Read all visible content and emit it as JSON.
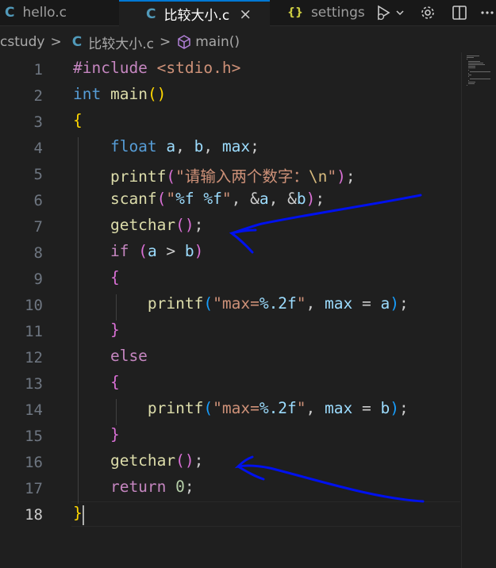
{
  "tabs": [
    {
      "icon": "C",
      "label": "hello.c"
    },
    {
      "icon": "C",
      "label": "比较大小.c",
      "close": "×"
    },
    {
      "icon": "{}",
      "label": "settings"
    }
  ],
  "breadcrumb": {
    "folder": "cstudy",
    "sep": ">",
    "file_icon": "C",
    "file": "比较大小.c",
    "symbol": "main()"
  },
  "code": {
    "line_numbers": [
      "1",
      "2",
      "3",
      "4",
      "5",
      "6",
      "7",
      "8",
      "9",
      "10",
      "11",
      "12",
      "13",
      "14",
      "15",
      "16",
      "17",
      "18"
    ],
    "active_line": "18",
    "lines": [
      [
        {
          "t": "#include ",
          "c": "ctrl"
        },
        {
          "t": "<stdio.h>",
          "c": "str"
        }
      ],
      [
        {
          "t": "int ",
          "c": "kw"
        },
        {
          "t": "main",
          "c": "fn"
        },
        {
          "t": "()",
          "c": "b1"
        }
      ],
      [
        {
          "t": "{",
          "c": "b1"
        }
      ],
      [
        {
          "t": "    float ",
          "c": "kw"
        },
        {
          "t": "a",
          "c": "var"
        },
        {
          "t": ", ",
          "c": "pun"
        },
        {
          "t": "b",
          "c": "var"
        },
        {
          "t": ", ",
          "c": "pun"
        },
        {
          "t": "max",
          "c": "var"
        },
        {
          "t": ";",
          "c": "pun"
        }
      ],
      [
        {
          "t": "    printf",
          "c": "fn"
        },
        {
          "t": "(",
          "c": "b2"
        },
        {
          "t": "\"请输入两个数字：",
          "c": "str"
        },
        {
          "t": "\\n",
          "c": "esc"
        },
        {
          "t": "\"",
          "c": "str"
        },
        {
          "t": ")",
          "c": "b2"
        },
        {
          "t": ";",
          "c": "pun"
        }
      ],
      [
        {
          "t": "    scanf",
          "c": "fn"
        },
        {
          "t": "(",
          "c": "b2"
        },
        {
          "t": "\"",
          "c": "str"
        },
        {
          "t": "%f",
          "c": "var"
        },
        {
          "t": " ",
          "c": "str"
        },
        {
          "t": "%f",
          "c": "var"
        },
        {
          "t": "\"",
          "c": "str"
        },
        {
          "t": ", &",
          "c": "pun"
        },
        {
          "t": "a",
          "c": "var"
        },
        {
          "t": ", &",
          "c": "pun"
        },
        {
          "t": "b",
          "c": "var"
        },
        {
          "t": ")",
          "c": "b2"
        },
        {
          "t": ";",
          "c": "pun"
        }
      ],
      [
        {
          "t": "    getchar",
          "c": "fn"
        },
        {
          "t": "()",
          "c": "b2"
        },
        {
          "t": ";",
          "c": "pun"
        }
      ],
      [
        {
          "t": "    if ",
          "c": "ctrl"
        },
        {
          "t": "(",
          "c": "b2"
        },
        {
          "t": "a",
          "c": "var"
        },
        {
          "t": " > ",
          "c": "pun"
        },
        {
          "t": "b",
          "c": "var"
        },
        {
          "t": ")",
          "c": "b2"
        }
      ],
      [
        {
          "t": "    {",
          "c": "b2"
        }
      ],
      [
        {
          "t": "        printf",
          "c": "fn"
        },
        {
          "t": "(",
          "c": "b3"
        },
        {
          "t": "\"max=",
          "c": "str"
        },
        {
          "t": "%.2f",
          "c": "var"
        },
        {
          "t": "\"",
          "c": "str"
        },
        {
          "t": ", ",
          "c": "pun"
        },
        {
          "t": "max",
          "c": "var"
        },
        {
          "t": " = ",
          "c": "pun"
        },
        {
          "t": "a",
          "c": "var"
        },
        {
          "t": ")",
          "c": "b3"
        },
        {
          "t": ";",
          "c": "pun"
        }
      ],
      [
        {
          "t": "    }",
          "c": "b2"
        }
      ],
      [
        {
          "t": "    else",
          "c": "ctrl"
        }
      ],
      [
        {
          "t": "    {",
          "c": "b2"
        }
      ],
      [
        {
          "t": "        printf",
          "c": "fn"
        },
        {
          "t": "(",
          "c": "b3"
        },
        {
          "t": "\"max=",
          "c": "str"
        },
        {
          "t": "%.2f",
          "c": "var"
        },
        {
          "t": "\"",
          "c": "str"
        },
        {
          "t": ", ",
          "c": "pun"
        },
        {
          "t": "max",
          "c": "var"
        },
        {
          "t": " = ",
          "c": "pun"
        },
        {
          "t": "b",
          "c": "var"
        },
        {
          "t": ")",
          "c": "b3"
        },
        {
          "t": ";",
          "c": "pun"
        }
      ],
      [
        {
          "t": "    }",
          "c": "b2"
        }
      ],
      [
        {
          "t": "    getchar",
          "c": "fn"
        },
        {
          "t": "()",
          "c": "b2"
        },
        {
          "t": ";",
          "c": "pun"
        }
      ],
      [
        {
          "t": "    return ",
          "c": "ctrl"
        },
        {
          "t": "0",
          "c": "num"
        },
        {
          "t": ";",
          "c": "pun"
        }
      ],
      [
        {
          "t": "}",
          "c": "b1"
        }
      ]
    ]
  },
  "annotation_color": "#0011ee"
}
